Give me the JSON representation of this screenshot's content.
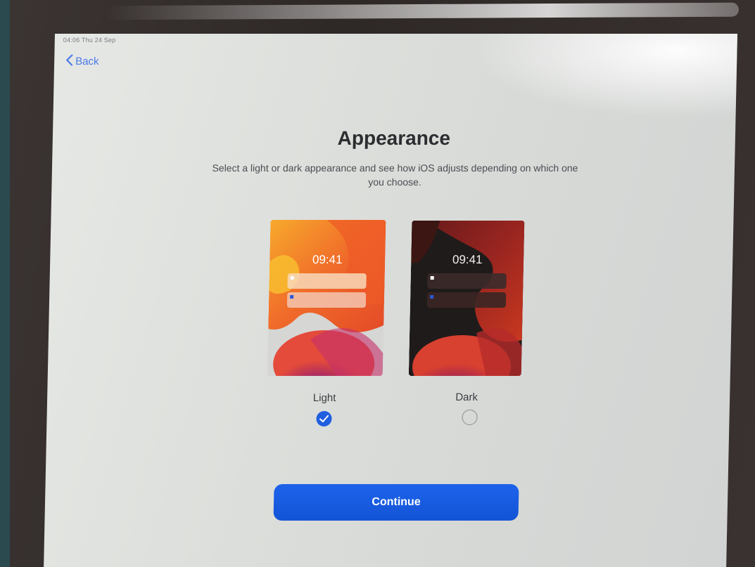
{
  "status_bar": {
    "time_date": "04:06  Thu 24 Sep"
  },
  "nav": {
    "back_label": "Back"
  },
  "header": {
    "title": "Appearance",
    "subtitle": "Select a light or dark appearance and see how iOS adjusts depending on which one you choose."
  },
  "options": [
    {
      "label": "Light",
      "preview_time": "09:41",
      "selected": true
    },
    {
      "label": "Dark",
      "preview_time": "09:41",
      "selected": false
    }
  ],
  "actions": {
    "continue_label": "Continue"
  },
  "colors": {
    "accent": "#1f5fe0",
    "link": "#4a7ae8"
  }
}
